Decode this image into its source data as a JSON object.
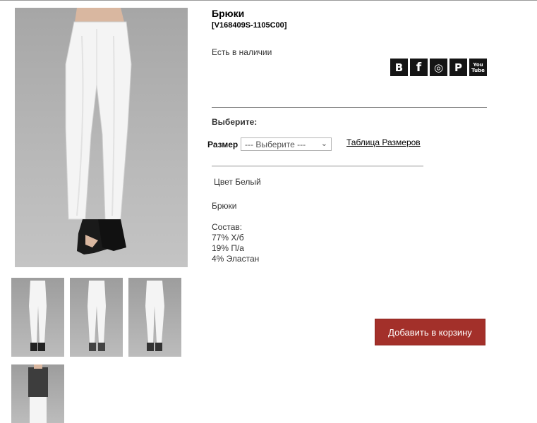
{
  "product": {
    "title": "Брюки",
    "sku": "[V168409S-1105C00]",
    "stock": "Есть в наличии"
  },
  "social": [
    {
      "label": "B",
      "icon": "vk-icon"
    },
    {
      "label": "f",
      "icon": "facebook-icon"
    },
    {
      "label": "◎",
      "icon": "instagram-icon"
    },
    {
      "label": "P",
      "icon": "pinterest-icon"
    },
    {
      "label": "You Tube",
      "icon": "youtube-icon"
    }
  ],
  "options": {
    "choose_label": "Выберите:",
    "size_label": "Размер",
    "size_select_value": "--- Выберите ---",
    "size_table_link": "Таблица Размеров"
  },
  "color_text": "Цвет Белый",
  "description": {
    "name": "Брюки",
    "composition_label": "Состав:",
    "composition": [
      "77% Х/б",
      "19% П/а",
      "4% Эластан"
    ]
  },
  "cart_button": "Добавить в корзину",
  "colors": {
    "cart_button": "#a3302a",
    "social_bg": "#151515"
  }
}
